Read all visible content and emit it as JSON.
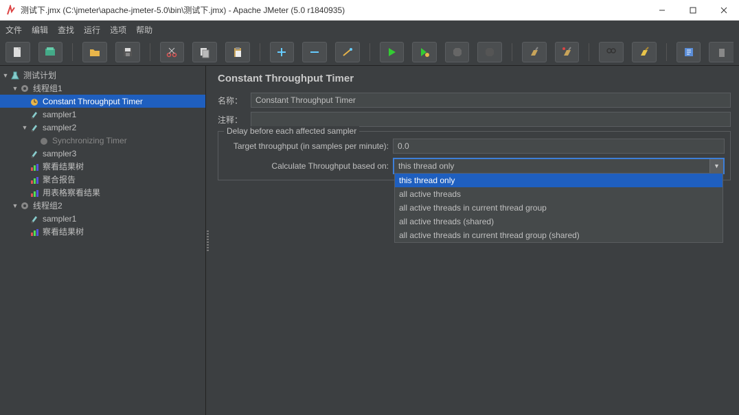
{
  "titlebar": {
    "title": "测试下.jmx (C:\\jmeter\\apache-jmeter-5.0\\bin\\测试下.jmx) - Apache JMeter (5.0 r1840935)"
  },
  "menu": {
    "file": "文件",
    "edit": "编辑",
    "search": "查找",
    "run": "运行",
    "options": "选项",
    "help": "帮助"
  },
  "tree": {
    "plan": "测试计划",
    "tg1": "线程组1",
    "ctt": "Constant Throughput Timer",
    "s1": "sampler1",
    "s2": "sampler2",
    "sync": "Synchronizing Timer",
    "s3": "sampler3",
    "tree_results": "察看结果树",
    "agg": "聚合报告",
    "table_results": "用表格察看结果",
    "tg2": "线程组2",
    "s1b": "sampler1",
    "tree_results2": "察看结果树"
  },
  "panel": {
    "title": "Constant Throughput Timer",
    "name_label": "名称：",
    "name_value": "Constant Throughput Timer",
    "comment_label": "注释：",
    "comment_value": "",
    "fieldset_legend": "Delay before each affected sampler",
    "target_label": "Target throughput (in samples per minute):",
    "target_value": "0.0",
    "calc_label": "Calculate Throughput based on:",
    "calc_value": "this thread only",
    "options": {
      "o0": "this thread only",
      "o1": "all active threads",
      "o2": "all active threads in current thread group",
      "o3": "all active threads (shared)",
      "o4": "all active threads in current thread group (shared)"
    }
  }
}
